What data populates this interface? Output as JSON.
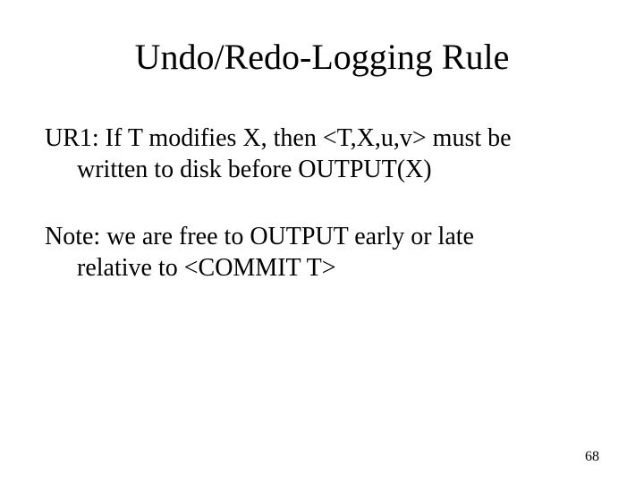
{
  "title": "Undo/Redo-Logging Rule",
  "para1_line1": "UR1: If T modifies X, then <T,X,u,v> must be",
  "para1_line2": "written to disk before OUTPUT(X)",
  "para2_line1": "Note: we are free to OUTPUT early or late",
  "para2_line2": "relative to <COMMIT T>",
  "page_number": "68"
}
